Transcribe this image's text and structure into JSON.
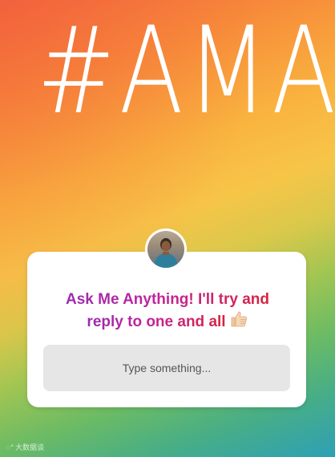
{
  "story": {
    "hashtag": "#AMA"
  },
  "question_sticker": {
    "prompt_line1": "Ask Me Anything! I'll try and",
    "prompt_line2": "reply to one and all",
    "placeholder": "Type something..."
  },
  "icons": {
    "avatar": "profile-avatar",
    "emoji": "thumbs-up-light-skin-icon"
  },
  "watermark": {
    "text": "大数据谈"
  },
  "colors": {
    "card_background": "#ffffff",
    "input_background": "#e6e6e6",
    "prompt_gradient_start": "#9b2bb0",
    "prompt_gradient_end": "#d8223e"
  }
}
